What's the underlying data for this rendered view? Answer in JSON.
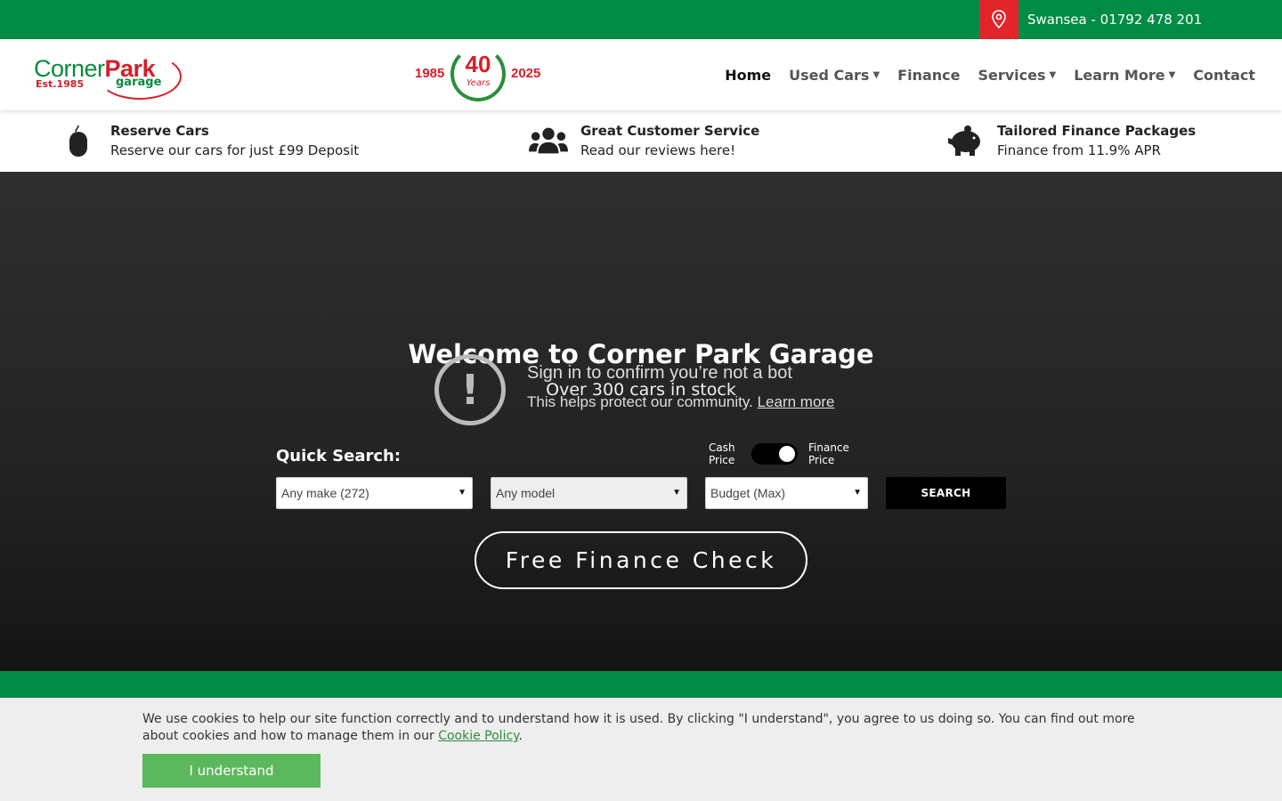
{
  "topbar": {
    "location_phone": "Swansea - 01792 478 201",
    "location_icon": "map-pin-icon"
  },
  "logo": {
    "corner": "Corner",
    "park": "Park",
    "est": "Est.1985",
    "garage": "garage"
  },
  "anniversary": {
    "year_start": "1985",
    "number": "40",
    "label": "Years",
    "year_end": "2025"
  },
  "nav": {
    "home": "Home",
    "used_cars": "Used Cars",
    "finance": "Finance",
    "services": "Services",
    "learn_more": "Learn More",
    "contact": "Contact"
  },
  "usp": [
    {
      "icon": "mouse-icon",
      "title": "Reserve Cars",
      "sub": "Reserve our cars for just £99 Deposit"
    },
    {
      "icon": "users-icon",
      "title": "Great Customer Service",
      "sub": "Read our reviews here!"
    },
    {
      "icon": "piggy-bank-icon",
      "title": "Tailored Finance Packages",
      "sub": "Finance from 11.9% APR"
    }
  ],
  "hero": {
    "title": "Welcome to Corner Park Garage",
    "subtitle": "Over 300 cars in stock",
    "bot_title": "Sign in to confirm you’re not a bot",
    "bot_text": "This helps protect our community.",
    "bot_link": "Learn more"
  },
  "search": {
    "label": "Quick Search:",
    "cash_label": "Cash Price",
    "finance_label": "Finance Price",
    "make": "Any make (272)",
    "model": "Any model",
    "budget": "Budget (Max)",
    "button": "SEARCH"
  },
  "ffc": "Free Finance Check",
  "cookie": {
    "text_before": "We use cookies to help our site function correctly and to understand how it is used. By clicking \"I understand\", you agree to us doing so. You can find out more about cookies and how to manage them in our ",
    "link": "Cookie Policy",
    "text_after": ".",
    "button": "I understand"
  }
}
